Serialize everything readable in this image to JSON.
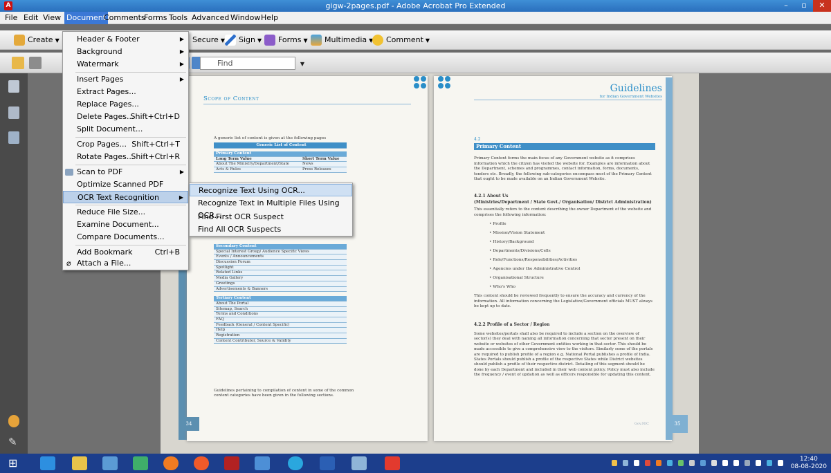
{
  "window": {
    "title": "gigw-2pages.pdf - Adobe Acrobat Pro Extended",
    "minimize": "–",
    "maximize": "▫",
    "close": "✕"
  },
  "menubar": [
    "File",
    "Edit",
    "View",
    "Document",
    "Comments",
    "Forms",
    "Tools",
    "Advanced",
    "Window",
    "Help"
  ],
  "toolbar": {
    "create": "Create",
    "secure": "Secure",
    "sign": "Sign",
    "forms": "Forms",
    "multimedia": "Multimedia",
    "comment": "Comment",
    "find_placeholder": "Find"
  },
  "document_menu": {
    "items": [
      {
        "label": "Header & Footer",
        "shortcut": "",
        "submenu": true
      },
      {
        "label": "Background",
        "shortcut": "",
        "submenu": true
      },
      {
        "label": "Watermark",
        "shortcut": "",
        "submenu": true
      },
      {
        "label": "Insert Pages",
        "shortcut": "",
        "submenu": true
      },
      {
        "label": "Extract Pages...",
        "shortcut": "",
        "submenu": false
      },
      {
        "label": "Replace Pages...",
        "shortcut": "",
        "submenu": false
      },
      {
        "label": "Delete Pages...",
        "shortcut": "Shift+Ctrl+D",
        "submenu": false
      },
      {
        "label": "Split Document...",
        "shortcut": "",
        "submenu": false
      },
      {
        "label": "Crop Pages...",
        "shortcut": "Shift+Ctrl+T",
        "submenu": false
      },
      {
        "label": "Rotate Pages...",
        "shortcut": "Shift+Ctrl+R",
        "submenu": false
      },
      {
        "label": "Scan to PDF",
        "shortcut": "",
        "submenu": true
      },
      {
        "label": "Optimize Scanned PDF",
        "shortcut": "",
        "submenu": false
      },
      {
        "label": "OCR Text Recognition",
        "shortcut": "",
        "submenu": true
      },
      {
        "label": "Reduce File Size...",
        "shortcut": "",
        "submenu": false
      },
      {
        "label": "Examine Document...",
        "shortcut": "",
        "submenu": false
      },
      {
        "label": "Compare Documents...",
        "shortcut": "",
        "submenu": false
      },
      {
        "label": "Add Bookmark",
        "shortcut": "Ctrl+B",
        "submenu": false
      },
      {
        "label": "Attach a File...",
        "shortcut": "",
        "submenu": false
      }
    ]
  },
  "ocr_submenu": [
    "Recognize Text Using OCR...",
    "Recognize Text in Multiple Files Using OCR...",
    "Find First OCR Suspect",
    "Find All OCR Suspects"
  ],
  "left_page": {
    "header": "Scope of Content",
    "intro": "A generic list of content is given at the following pages",
    "table_title": "Generic List of Content",
    "primary_head": "Primary Content",
    "col1": "Long Term Value",
    "col2": "Short Term Value",
    "primary_rows": [
      [
        "About The Ministry/Department/State",
        "News"
      ],
      [
        "Acts & Rules",
        "Press Releases"
      ]
    ],
    "secondary_head": "Secondary Content",
    "secondary_rows": [
      "Special Interest Group/ Audience Specific Views",
      "Events / Announcements",
      "Discussion Forum",
      "Spotlight",
      "Related Links",
      "Media Gallery",
      "Greetings",
      "Advertisements & Banners"
    ],
    "tertiary_head": "Tertiary Content",
    "tertiary_rows": [
      "About The Portal",
      "Sitemap, Search",
      "Terms and Conditions",
      "FAQ",
      "Feedback (General / Content Specific)",
      "Help",
      "Registration",
      "Content Contributor, Source & Validity"
    ],
    "footer": "Guidelines pertaining to compilation of content in some of the common content categories have been given in the following sections.",
    "page_num": "34"
  },
  "right_page": {
    "title": "Guidelines",
    "subtitle": "for Indian Government Websites",
    "section_num": "4.2",
    "section_title": "Primary Content",
    "para1": "Primary Content forms the main focus of any Government website as it comprises information which the citizen has visited the website for. Examples are information about the Department, schemes and programmes, contact information, forms, documents, tenders etc. Broadly, the following sub-categories encompass most of the Primary Content that ought to be made available on an Indian Government Website.",
    "h421": "4.2.1 About Us",
    "h421b": "(Ministries/Department / State Govt./ Organisation/ District Administration)",
    "para2": "This essentially refers to the content describing the owner Department of the website and comprises the following information:",
    "bullets": [
      "Profile",
      "Mission/Vision Statement",
      "History/Background",
      "Departments/Divisions/Cells",
      "Role/Functions/Responsibilities/Activities",
      "Agencies under the Administrative Control",
      "Organisational Structure",
      "Who's Who"
    ],
    "para3": "This content should be reviewed frequently to ensure the accuracy and currency of the information. All information concerning the Legislative/Government officials MUST always be kept up to date.",
    "h422": "4.2.2 Profile of a Sector / Region",
    "para4": "Some websites/portals shall also be required to include a section on the overview of sector(s) they deal with naming all information concerning that sector present on their website or websites of other Government entities working in that sector. This should be made accessible to give a comprehensive view to the visitors. Similarly some of the portals are required to publish profile of a region e.g. National Portal publishes a profile of India. States Portals should publish a profile of the respective States while District websites should publish a profile of their respective district. Detailing of this segment should be done by each Department and included in their web content policy. Policy must also include the frequency / event of updation as well as officers responsible for updating this content.",
    "footer_mark": "Gov.NIC",
    "page_num": "35"
  },
  "clock": {
    "time": "12:40",
    "date": "08-08-2020"
  },
  "colors": {
    "accent": "#3b78d6",
    "titlebar": "#2a6fbd",
    "taskbar": "#1c3e8c",
    "page_blue": "#2a8ec8"
  }
}
